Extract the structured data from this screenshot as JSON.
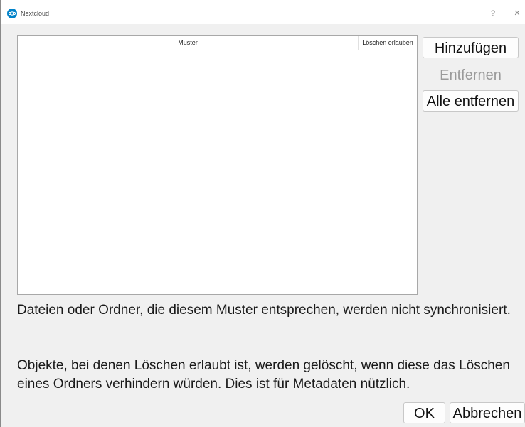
{
  "window": {
    "title": "Nextcloud",
    "help_button": "?",
    "close_button": "✕"
  },
  "table": {
    "columns": [
      "Muster",
      "Löschen erlauben"
    ],
    "rows": []
  },
  "side_buttons": {
    "add": "Hinzufügen",
    "remove": "Entfernen",
    "remove_all": "Alle entfernen"
  },
  "info": {
    "line1": "Dateien oder Ordner, die diesem Muster entsprechen, werden nicht synchronisiert.",
    "line2": "Objekte, bei denen Löschen erlaubt ist, werden gelöscht, wenn diese das Löschen eines Ordners verhindern würden. Dies ist für Metadaten nützlich."
  },
  "dialog_buttons": {
    "ok": "OK",
    "cancel": "Abbrechen"
  },
  "colors": {
    "accent": "#0082c9",
    "disabled_text": "#9a9a9a"
  }
}
